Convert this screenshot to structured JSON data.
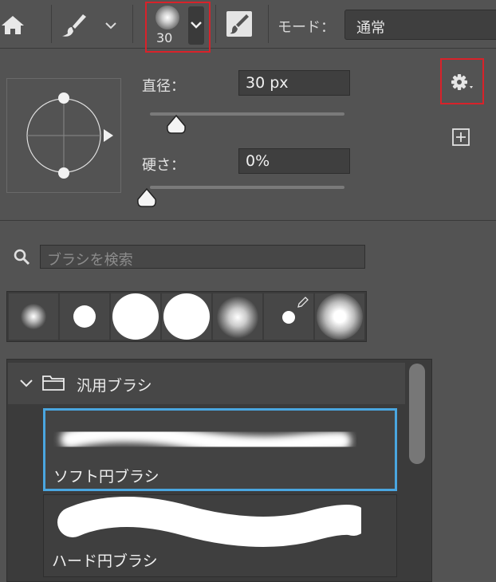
{
  "toolbar": {
    "home_icon": "home-icon",
    "brush_tool_icon": "brush-icon",
    "brush_preset_size": "30",
    "toggle_panel_icon": "brush-panel-toggle-icon",
    "mode_label": "モード：",
    "mode_value": "通常"
  },
  "settings": {
    "diameter_label": "直径：",
    "diameter_value": "30 px",
    "diameter_level": 0.2,
    "hardness_label": "硬さ：",
    "hardness_value": "0%",
    "hardness_level": 0.0,
    "gear_icon": "gear-icon",
    "new_preset_icon": "add-icon"
  },
  "search": {
    "placeholder": "ブラシを検索",
    "icon": "search-icon"
  },
  "brush_list": {
    "group_name": "汎用ブラシ",
    "items": [
      {
        "name": "ソフト円ブラシ",
        "selected": true
      },
      {
        "name": "ハード円ブラシ",
        "selected": false
      }
    ]
  },
  "colors": {
    "highlight_red": "#d8222a",
    "selection_blue": "#4aa6e0"
  }
}
